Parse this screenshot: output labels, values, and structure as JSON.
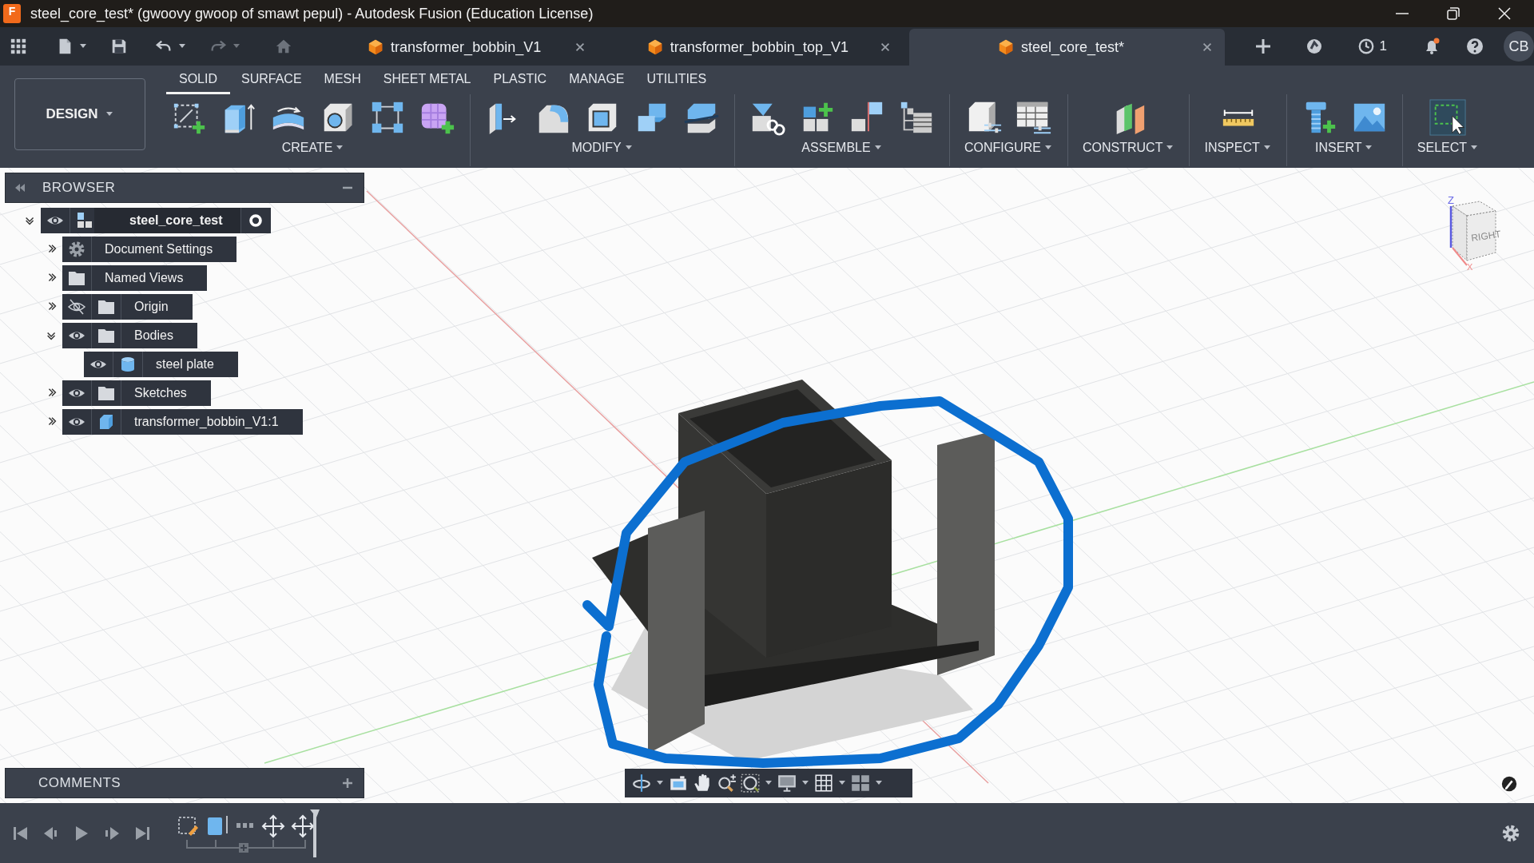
{
  "window": {
    "app_letter": "F",
    "title": "steel_core_test* (gwoovy gwoop of smawt pepul) - Autodesk Fusion (Education License)"
  },
  "document_tabs": [
    {
      "label": "transformer_bobbin_V1",
      "selected": false
    },
    {
      "label": "transformer_bobbin_top_V1",
      "selected": false
    },
    {
      "label": "steel_core_test*",
      "selected": true
    }
  ],
  "job_count": "1",
  "user_initials": "CB",
  "workspace": "DESIGN",
  "ribbon_tabs": [
    {
      "label": "SOLID",
      "selected": true
    },
    {
      "label": "SURFACE",
      "selected": false
    },
    {
      "label": "MESH",
      "selected": false
    },
    {
      "label": "SHEET METAL",
      "selected": false
    },
    {
      "label": "PLASTIC",
      "selected": false
    },
    {
      "label": "MANAGE",
      "selected": false
    },
    {
      "label": "UTILITIES",
      "selected": false
    }
  ],
  "tool_groups": [
    {
      "label": "CREATE"
    },
    {
      "label": "MODIFY"
    },
    {
      "label": "ASSEMBLE"
    },
    {
      "label": "CONFIGURE"
    },
    {
      "label": "CONSTRUCT"
    },
    {
      "label": "INSPECT"
    },
    {
      "label": "INSERT"
    },
    {
      "label": "SELECT"
    }
  ],
  "browser": {
    "title": "BROWSER",
    "root": {
      "kind": "root",
      "label": "steel_core_test",
      "expanded": true,
      "visible": true,
      "children": [
        {
          "kind": "settings",
          "label": "Document Settings",
          "expanded": false
        },
        {
          "kind": "folder",
          "label": "Named Views",
          "expanded": false
        },
        {
          "kind": "folder",
          "label": "Origin",
          "expanded": false,
          "visible": false
        },
        {
          "kind": "folder",
          "label": "Bodies",
          "expanded": true,
          "visible": true,
          "children": [
            {
              "kind": "body",
              "label": "steel plate",
              "visible": true
            }
          ]
        },
        {
          "kind": "folder",
          "label": "Sketches",
          "expanded": false,
          "visible": true
        },
        {
          "kind": "component",
          "label": "transformer_bobbin_V1:1",
          "expanded": false,
          "visible": true
        }
      ]
    }
  },
  "viewcube": {
    "z_label": "Z",
    "x_label": "X",
    "face_label": "RIGHT"
  },
  "comments": {
    "title": "COMMENTS"
  }
}
